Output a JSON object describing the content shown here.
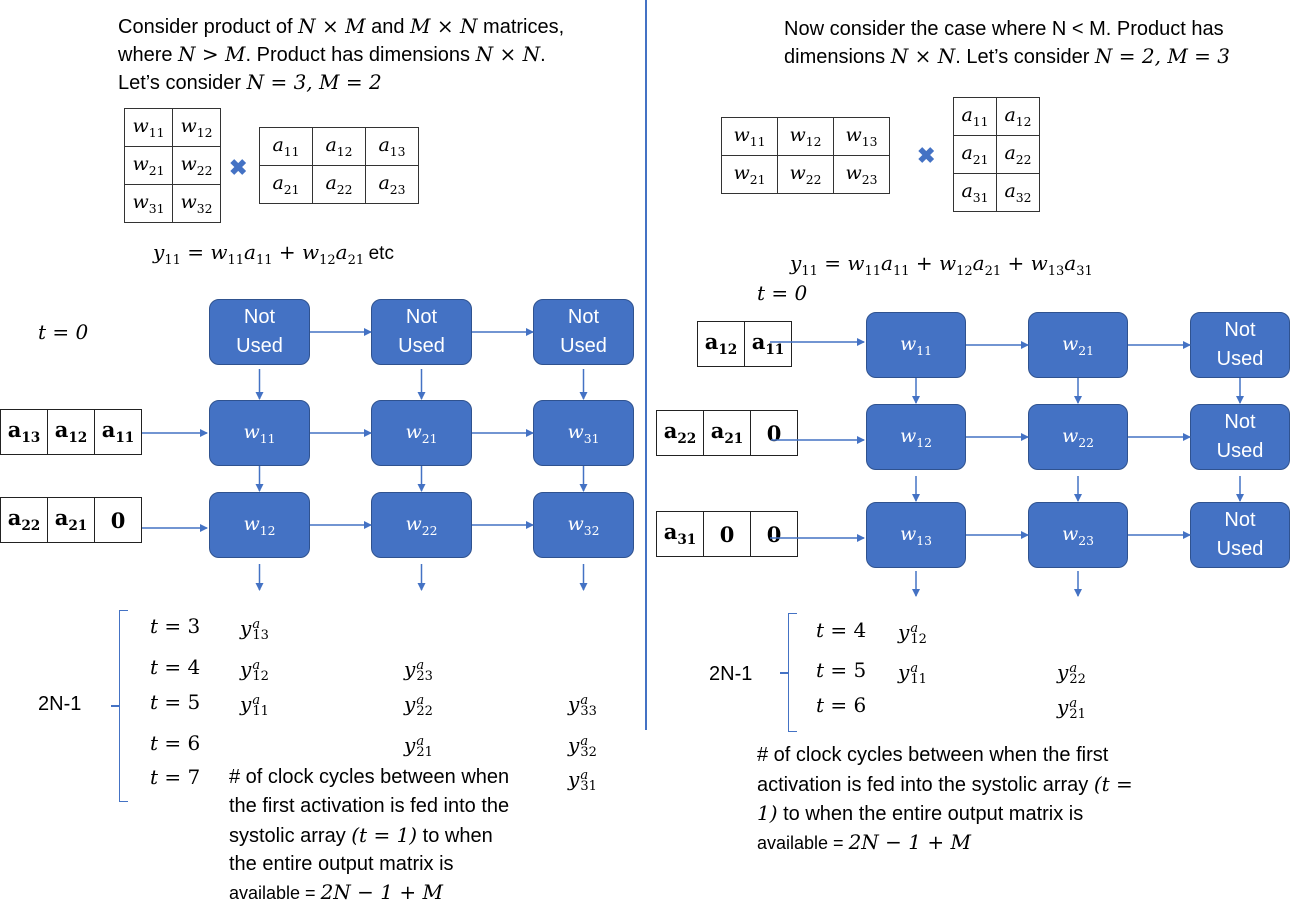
{
  "left": {
    "intro": {
      "line1_pre": "Consider product of ",
      "line1_m1": "N × M",
      "line1_mid": " and ",
      "line1_m2": "M × N",
      "line1_post": " matrices,",
      "line2_pre": "where ",
      "line2_m1": "N > M",
      "line2_mid": ". Product has dimensions ",
      "line2_m2": "N × N",
      "line2_post": ".",
      "line3_pre": "Let’s consider ",
      "line3_m": "N = 3, M = 2"
    },
    "w_matrix": [
      [
        "w11",
        "w12"
      ],
      [
        "w21",
        "w22"
      ],
      [
        "w31",
        "w32"
      ]
    ],
    "a_matrix": [
      [
        "a11",
        "a12",
        "a13"
      ],
      [
        "a21",
        "a22",
        "a23"
      ]
    ],
    "equation": "y11 = w11a11 + w12a21",
    "equation_suffix": "etc",
    "time_label": "t = 0",
    "pe_grid": [
      [
        "Not Used",
        "Not Used",
        "Not Used"
      ],
      [
        "w11",
        "w21",
        "w31"
      ],
      [
        "w12",
        "w22",
        "w32"
      ]
    ],
    "activation_rows": [
      [
        "a13",
        "a12",
        "a11"
      ],
      [
        "a22",
        "a21",
        "0"
      ]
    ],
    "brace_label": "2N-1",
    "timeline": [
      {
        "t": "t = 3",
        "col1": "13",
        "col2": "",
        "col3": ""
      },
      {
        "t": "t = 4",
        "col1": "12",
        "col2": "23",
        "col3": ""
      },
      {
        "t": "t = 5",
        "col1": "11",
        "col2": "22",
        "col3": "33"
      },
      {
        "t": "t = 6",
        "col1": "",
        "col2": "21",
        "col3": "32"
      },
      {
        "t": "t = 7",
        "col1": "",
        "col2": "",
        "col3": "31"
      }
    ],
    "summary": {
      "line1": "# of clock cycles between when",
      "line2": "the first activation is fed into the",
      "line3_pre": "systolic array ",
      "line3_m": "(t = 1)",
      "line3_post": " to when",
      "line4": "the entire output matrix is",
      "line5_pre": "available = ",
      "line5_m": "2N − 1 + M"
    }
  },
  "right": {
    "intro": {
      "line1": "Now consider the case where N < M. Product has",
      "line2_pre": "dimensions ",
      "line2_m1": "N × N",
      "line2_mid": ". Let’s consider ",
      "line2_m2": "N = 2, M = 3"
    },
    "w_matrix": [
      [
        "w11",
        "w12",
        "w13"
      ],
      [
        "w21",
        "w22",
        "w23"
      ]
    ],
    "a_matrix": [
      [
        "a11",
        "a12"
      ],
      [
        "a21",
        "a22"
      ],
      [
        "a31",
        "a32"
      ]
    ],
    "equation": "y11 = w11a11 + w12a21 + w13a31",
    "time_label": "t = 0",
    "pe_grid": [
      [
        "w11",
        "w21",
        "Not Used"
      ],
      [
        "w12",
        "w22",
        "Not Used"
      ],
      [
        "w13",
        "w23",
        "Not Used"
      ]
    ],
    "activation_rows": [
      [
        "a12",
        "a11"
      ],
      [
        "a22",
        "a21",
        "0"
      ],
      [
        "a31",
        "0",
        "0"
      ]
    ],
    "brace_label": "2N-1",
    "timeline": [
      {
        "t": "t = 4",
        "col1": "12",
        "col2": ""
      },
      {
        "t": "t = 5",
        "col1": "11",
        "col2": "22"
      },
      {
        "t": "t = 6",
        "col1": "",
        "col2": "21"
      }
    ],
    "summary": {
      "line1": "# of clock cycles between when the first",
      "line2_pre": "activation is fed into the systolic array ",
      "line2_m": "(t =",
      "line3_m": "1)",
      "line3_post": " to when the entire output matrix is",
      "line4_pre": "available = ",
      "line4_m": "2N − 1 + M"
    }
  },
  "colors": {
    "accent": "#4472c4",
    "pe_border": "#2f528f"
  },
  "output_superscript": "a",
  "output_symbol": "y"
}
